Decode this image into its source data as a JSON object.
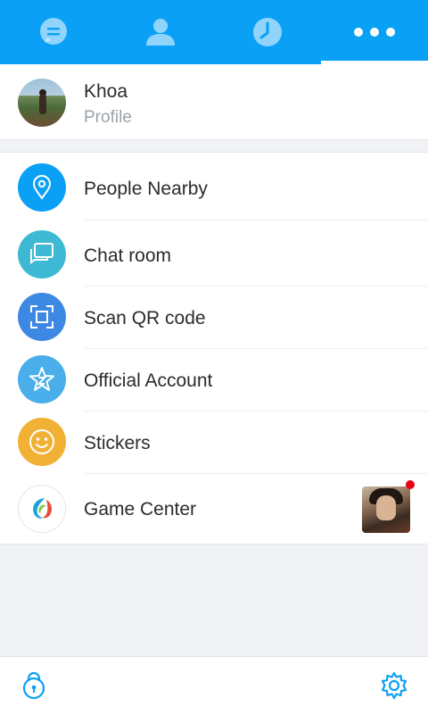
{
  "tabs": [
    {
      "icon": "chat-bubble-icon",
      "active": false
    },
    {
      "icon": "contacts-icon",
      "active": false
    },
    {
      "icon": "clock-icon",
      "active": false
    },
    {
      "icon": "more-icon",
      "active": true
    }
  ],
  "colors": {
    "accent": "#0aa0f5",
    "nearby": "#0aa0f5",
    "chatroom": "#3db9d3",
    "qr": "#3d88e3",
    "official": "#4aaeea",
    "stickers": "#f0b135",
    "badge": "#e60012"
  },
  "profile": {
    "name": "Khoa",
    "subtitle": "Profile"
  },
  "menu": [
    {
      "label": "People Nearby",
      "icon": "location-pin-icon"
    },
    {
      "label": "Chat room",
      "icon": "chat-room-icon"
    },
    {
      "label": "Scan QR code",
      "icon": "scan-qr-icon"
    },
    {
      "label": "Official Account",
      "icon": "official-star-icon"
    },
    {
      "label": "Stickers",
      "icon": "smiley-icon"
    },
    {
      "label": "Game Center",
      "icon": "game-center-icon"
    }
  ],
  "bottom": {
    "left_icon": "lock-icon",
    "right_icon": "gear-icon"
  }
}
